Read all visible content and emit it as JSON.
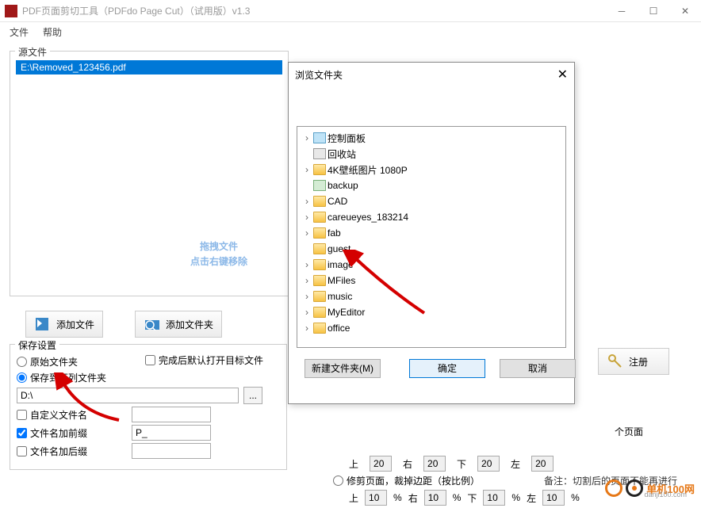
{
  "window": {
    "title": "PDF页面剪切工具（PDFdo Page Cut）（试用版）v1.3",
    "menu": {
      "file": "文件",
      "help": "帮助"
    }
  },
  "source": {
    "legend": "源文件",
    "file": "E:\\Removed_123456.pdf",
    "watermark_line1": "拖拽文件",
    "watermark_line2": "点击右键移除"
  },
  "toolbar": {
    "add_file": "添加文件",
    "add_folder": "添加文件夹",
    "register": "注册"
  },
  "save": {
    "legend": "保存设置",
    "auto_open": "完成后默认打开目标文件",
    "original_folder": "原始文件夹",
    "save_to_folder": "保存到下列文件夹",
    "path": "D:\\",
    "custom_name": "自定义文件名",
    "add_prefix": "文件名加前缀",
    "prefix_value": "P_",
    "add_suffix": "文件名加后缀",
    "suffix_value": ""
  },
  "pages_suffix": "个页面",
  "crop": {
    "radio": "修剪页面，裁掉边距（按比例）",
    "up": "上",
    "down": "下",
    "left": "左",
    "right": "右",
    "v1": "20",
    "v2": "20",
    "v3": "20",
    "v4": "20",
    "p1": "10",
    "p2": "10",
    "p3": "10",
    "p4": "10",
    "pct": "%"
  },
  "remark": "备注：切割后的页面不能再进行",
  "dialog": {
    "title": "浏览文件夹",
    "new_folder": "新建文件夹(M)",
    "ok": "确定",
    "cancel": "取消",
    "items": [
      {
        "icon": "panel",
        "label": "控制面板",
        "exp": "›"
      },
      {
        "icon": "bin",
        "label": "回收站",
        "exp": ""
      },
      {
        "icon": "folder",
        "label": "4K壁纸图片 1080P",
        "exp": "›"
      },
      {
        "icon": "drive",
        "label": "backup",
        "exp": ""
      },
      {
        "icon": "folder",
        "label": "CAD",
        "exp": "›"
      },
      {
        "icon": "folder",
        "label": "careueyes_183214",
        "exp": "›"
      },
      {
        "icon": "folder",
        "label": "fab",
        "exp": "›"
      },
      {
        "icon": "folder",
        "label": "guest",
        "exp": ""
      },
      {
        "icon": "folder",
        "label": "image",
        "exp": "›"
      },
      {
        "icon": "folder",
        "label": "MFiles",
        "exp": "›"
      },
      {
        "icon": "folder",
        "label": "music",
        "exp": "›"
      },
      {
        "icon": "folder",
        "label": "MyEditor",
        "exp": "›"
      },
      {
        "icon": "folder",
        "label": "office",
        "exp": "›"
      }
    ]
  },
  "logo": {
    "brand": "单机100网",
    "url": "danji100.com"
  }
}
